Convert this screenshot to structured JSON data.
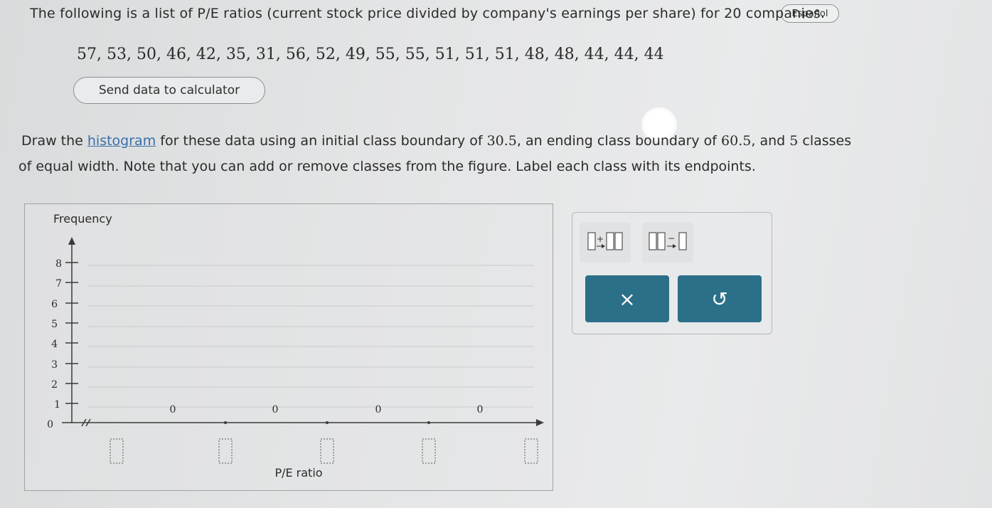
{
  "header": {
    "language_button": "Español"
  },
  "problem": {
    "intro": "The following is a list of P/E ratios (current stock price divided by company's earnings per share) for 20 companies.",
    "data_values": "57, 53, 50, 46, 42, 35, 31, 56, 52, 49, 55, 55, 51, 51, 51, 48, 48, 44, 44, 44",
    "send_button": "Send data to calculator",
    "instr_p1": "Draw the ",
    "instr_link": "histogram",
    "instr_p2": " for these data using an initial class boundary of ",
    "instr_num1": "30.5",
    "instr_p3": ", an ending class boundary of ",
    "instr_num2": "60.5",
    "instr_p4": ", and ",
    "instr_num3": "5",
    "instr_p5": " classes",
    "instr_line2": "of equal width. Note that you can add or remove classes from the figure. Label each class with its endpoints."
  },
  "graph": {
    "y_axis_title": "Frequency",
    "x_axis_title": "P/E ratio",
    "y_ticks": [
      "0",
      "1",
      "2",
      "3",
      "4",
      "5",
      "6",
      "7",
      "8"
    ],
    "class_frequencies": [
      "0",
      "0",
      "0",
      "0"
    ],
    "boundary_inputs": [
      "",
      "",
      "",
      "",
      ""
    ]
  },
  "toolbar": {
    "add_class_icon": "add-class-icon",
    "remove_class_icon": "remove-class-icon",
    "clear_label": "×",
    "undo_label": "↺",
    "button_color": "#2c6f89"
  }
}
